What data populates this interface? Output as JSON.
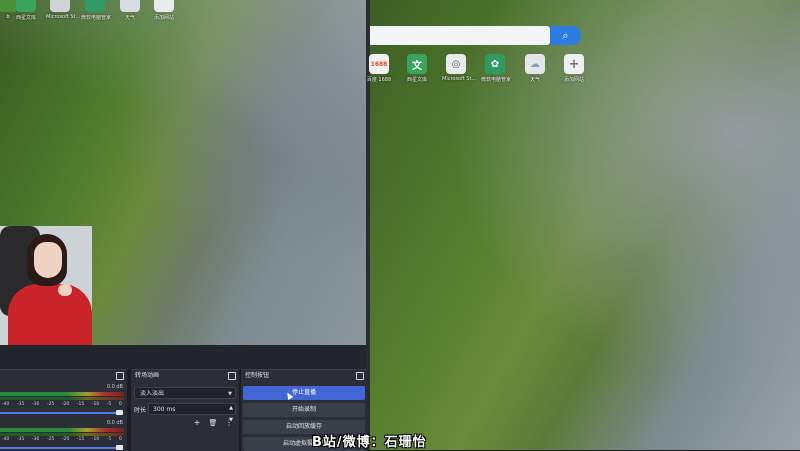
{
  "left_icons": [
    {
      "label": "b",
      "icon": "app-icon",
      "color": "#4b8f3a"
    },
    {
      "label": "西星文库",
      "icon": "library-icon",
      "color": "#3aa35c"
    },
    {
      "label": "Microsoft St...",
      "icon": "store-icon",
      "color": "#cfd3d8"
    },
    {
      "label": "微软电脑管家",
      "icon": "pc-manager-icon",
      "color": "#2f9a62"
    },
    {
      "label": "天气",
      "icon": "weather-icon",
      "color": "#d8dde2"
    },
    {
      "label": "添加网站",
      "icon": "add-site-icon",
      "color": "#e9ecef"
    }
  ],
  "right_icons": [
    {
      "label": "百度 1688",
      "icon": "1688-icon",
      "color": "#f2f2f2",
      "glyph": "1688"
    },
    {
      "label": "西星文库",
      "icon": "library-icon",
      "color": "#3aa35c",
      "glyph": "文"
    },
    {
      "label": "Microsoft St...",
      "icon": "store-icon",
      "color": "#e8eaec",
      "glyph": "◎"
    },
    {
      "label": "微软电脑管家",
      "icon": "pc-manager-icon",
      "color": "#2f9a62",
      "glyph": "✿"
    },
    {
      "label": "天气",
      "icon": "weather-icon",
      "color": "#e3e7ea",
      "glyph": "☁"
    },
    {
      "label": "添加网站",
      "icon": "add-site-icon",
      "color": "#eef0f2",
      "glyph": "+"
    }
  ],
  "search": {
    "placeholder": "",
    "button_icon": "search-icon"
  },
  "audio_mixer": {
    "db_top": "0.0 dB",
    "db_bottom": "0.0 dB",
    "ticks": [
      "-40",
      "-35",
      "-30",
      "-25",
      "-20",
      "-15",
      "-10",
      "-5",
      "0"
    ]
  },
  "transitions": {
    "title": "转场动画",
    "selected": "淡入淡出",
    "duration_label": "时长",
    "duration_value": "300 ms",
    "add": "+",
    "delete": "🗑",
    "more": "⋮"
  },
  "controls": {
    "title": "控制按钮",
    "stop_stream": "停止直播",
    "start_record": "开始录制",
    "start_replay": "启动回放缓存",
    "start_virtual": "启动虚拟摄像机"
  },
  "watermark": "B站/微博：石珊怡"
}
